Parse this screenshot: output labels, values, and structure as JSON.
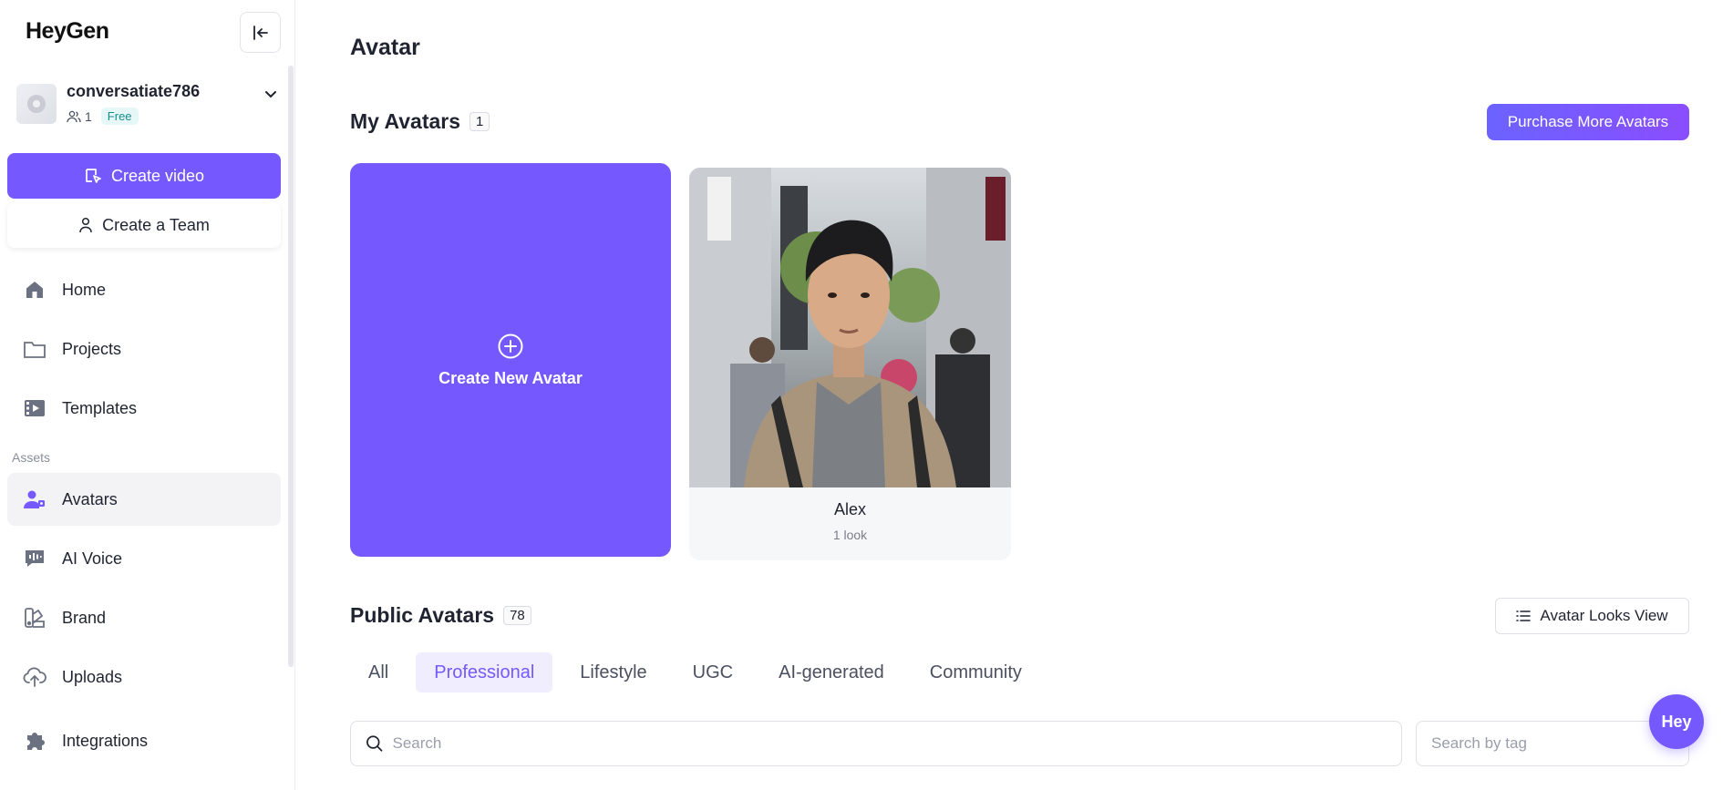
{
  "brand": {
    "logo_text": "HeyGen",
    "accent": "#7559ff"
  },
  "account": {
    "name": "conversatiate786",
    "members": "1",
    "plan": "Free"
  },
  "sidebar": {
    "create_video_label": "Create video",
    "create_team_label": "Create a Team",
    "items": [
      {
        "label": "Home",
        "icon": "home-icon"
      },
      {
        "label": "Projects",
        "icon": "folder-icon"
      },
      {
        "label": "Templates",
        "icon": "film-icon"
      }
    ],
    "assets_label": "Assets",
    "asset_items": [
      {
        "label": "Avatars",
        "icon": "avatar-icon",
        "active": true
      },
      {
        "label": "AI Voice",
        "icon": "voice-icon"
      },
      {
        "label": "Brand",
        "icon": "palette-icon"
      },
      {
        "label": "Uploads",
        "icon": "upload-cloud-icon"
      },
      {
        "label": "Integrations",
        "icon": "puzzle-icon"
      }
    ]
  },
  "main": {
    "page_title": "Avatar",
    "my_avatars": {
      "title": "My Avatars",
      "count": "1",
      "purchase_label": "Purchase More Avatars",
      "create_label": "Create New Avatar",
      "avatars": [
        {
          "name": "Alex",
          "looks": "1 look"
        }
      ]
    },
    "public_avatars": {
      "title": "Public Avatars",
      "count": "78",
      "looks_view_label": "Avatar Looks View",
      "tabs": [
        "All",
        "Professional",
        "Lifestyle",
        "UGC",
        "AI-generated",
        "Community"
      ],
      "active_tab": "Professional",
      "search_placeholder": "Search",
      "tag_placeholder": "Search by tag"
    },
    "fab_label": "Hey"
  }
}
